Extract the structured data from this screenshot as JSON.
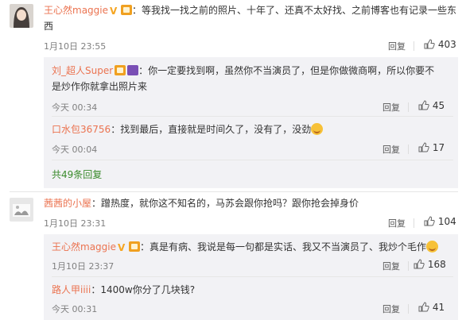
{
  "comments": [
    {
      "username": "王心然maggie",
      "text_line1": "：等我找一找之前的照片、十年了、还真不太好找、之前博客也有记录一些东",
      "text_line2": "西",
      "time": "1月10日 23:55",
      "reply_label": "回复",
      "likes": "403"
    },
    {
      "username": "茜茜的小屋",
      "text_line1": "：蹭热度，就你这不知名的，马苏会跟你抢吗？跟你抢会掉身价",
      "time": "1月10日 23:31",
      "reply_label": "回复",
      "likes": "104"
    }
  ],
  "replies_a": [
    {
      "username": "刘_超人Super",
      "text_line1": "：你一定要找到啊，虽然你不当演员了，但是你做微商啊，所以你要不",
      "text_line2": "是炒作你就拿出照片来",
      "time": "今天 00:34",
      "reply_label": "回复",
      "likes": "45"
    },
    {
      "username": "口水包36756",
      "text_line1": "：找到最后，直接就是时间久了，没有了，没劲",
      "time": "今天 00:04",
      "reply_label": "回复",
      "likes": "17"
    }
  ],
  "more_replies": "共49条回复",
  "replies_b": [
    {
      "username": "王心然maggie",
      "text_line1": "：真是有病、我说是每一句都是实话、我又不当演员了、我炒个毛作",
      "time": "1月10日 23:37",
      "reply_label": "回复",
      "likes": "168"
    },
    {
      "username": "路人甲iiii",
      "text_line1": "：1400w你分了几块钱?",
      "time": "今天 00:31",
      "reply_label": "回复",
      "likes": "41"
    }
  ],
  "colors": {
    "username": "#eb7350",
    "more_link": "#3a8b2c",
    "reply_bg": "#f2f2f5"
  }
}
